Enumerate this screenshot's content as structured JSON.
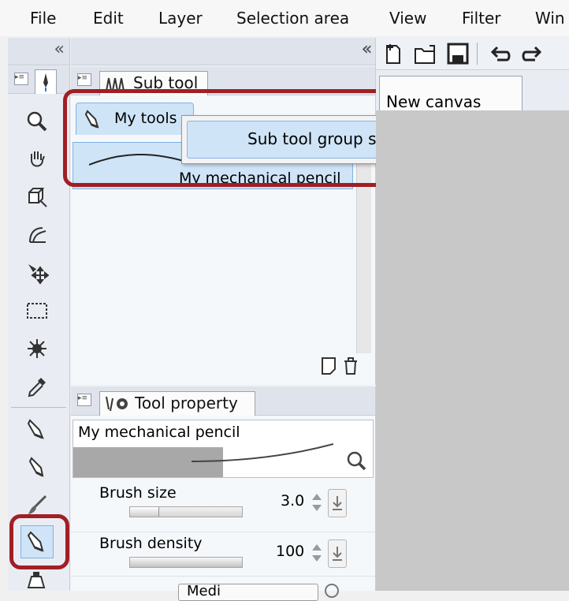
{
  "menu": [
    "File",
    "Edit",
    "Layer",
    "Selection area",
    "View",
    "Filter",
    "Win"
  ],
  "subtool_panel": {
    "tab_label": "Sub tool",
    "group_tab_label": "My tools",
    "selected_tool_label": "My mechanical pencil"
  },
  "context_menu": {
    "item": "Sub tool group settings..."
  },
  "canvas_tab_label": "New canvas",
  "tool_property": {
    "tab_label": "Tool property",
    "tool_name": "My mechanical pencil",
    "brush_size_label": "Brush size",
    "brush_size_value": "3.0",
    "brush_density_label": "Brush density",
    "brush_density_value": "100",
    "partial_dropdown_label": "Medi"
  },
  "colors": {
    "highlight_red": "#a01f24",
    "selection_blue": "#cfe4f7",
    "panel_bg": "#f5f8fb",
    "canvas_bg": "#c8c8c8"
  }
}
